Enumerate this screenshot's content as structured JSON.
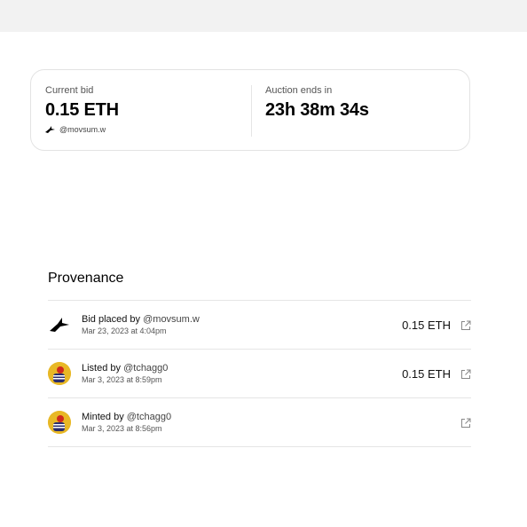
{
  "bid_card": {
    "current_bid_label": "Current bid",
    "current_bid_value": "0.15 ETH",
    "bidder_handle": "@movsum.w",
    "auction_label": "Auction ends in",
    "auction_countdown": "23h 38m 34s"
  },
  "provenance": {
    "title": "Provenance",
    "events": [
      {
        "action": "Bid placed by",
        "handle": "@movsum.w",
        "date": "Mar 23, 2023 at 4:04pm",
        "amount": "0.15 ETH",
        "avatar": "bird-icon"
      },
      {
        "action": "Listed by",
        "handle": "@tchagg0",
        "date": "Mar 3, 2023 at 8:59pm",
        "amount": "0.15 ETH",
        "avatar": "user-avatar"
      },
      {
        "action": "Minted by",
        "handle": "@tchagg0",
        "date": "Mar 3, 2023 at 8:56pm",
        "amount": "",
        "avatar": "user-avatar"
      }
    ]
  },
  "colors": {
    "top_bar": "#f2f2f2",
    "avatar_bg": "#e8b826",
    "divider": "#e5e5e5"
  }
}
